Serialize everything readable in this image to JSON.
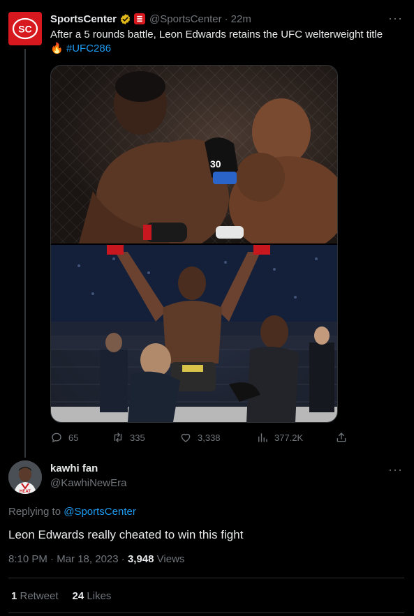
{
  "tweet": {
    "author_name": "SportsCenter",
    "handle": "@SportsCenter",
    "separator": "·",
    "time": "22m",
    "text": "After a 5 rounds battle, Leon Edwards retains the UFC welterweight title",
    "emoji": "🔥",
    "hashtag": "#UFC286",
    "more": "···",
    "stats": {
      "replies": "65",
      "retweets": "335",
      "likes": "3,338",
      "views": "377.2K"
    }
  },
  "reply": {
    "author_name": "kawhi fan",
    "handle": "@KawhiNewEra",
    "more": "···",
    "replying_prefix": "Replying to ",
    "replying_to": "@SportsCenter",
    "text": "Leon Edwards really cheated to win this fight",
    "time": "8:10 PM",
    "dot1": " · ",
    "date": "Mar 18, 2023",
    "dot2": " · ",
    "views_count": "3,948",
    "views_label": " Views",
    "retweet_count": "1",
    "retweet_label": " Retweet",
    "like_count": "24",
    "like_label": " Likes"
  },
  "colors": {
    "background": "#000000",
    "text": "#e7e9ea",
    "muted": "#71767b",
    "link": "#1d9bf0",
    "divider": "#2f3336",
    "espn_red": "#d7191f",
    "verified_gold": "#e2b719"
  },
  "icons": {
    "reply": "speech-bubble-icon",
    "retweet": "retweet-arrows-icon",
    "like": "heart-icon",
    "views": "bar-chart-icon",
    "share": "share-upload-icon"
  }
}
